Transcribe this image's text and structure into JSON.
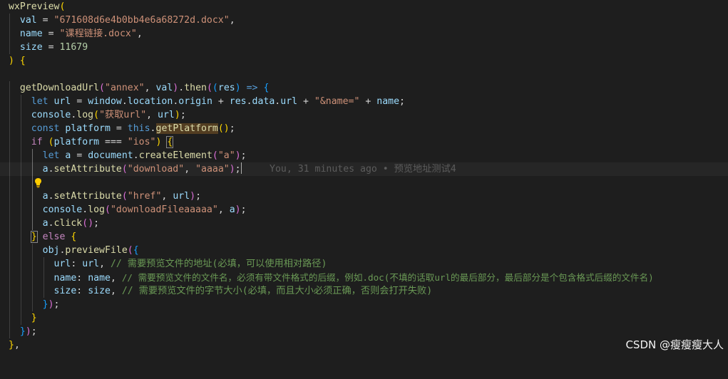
{
  "code": {
    "l1_fn": "wxPreview",
    "l1_paren": "(",
    "l2_name": "val",
    "l2_val": "\"671608d6e4b0bb4e6a68272d.docx\"",
    "l3_name": "name",
    "l3_val": "\"课程链接.docx\"",
    "l4_name": "size",
    "l4_val": "11679",
    "l5_close": ")",
    "l5_brace": "{",
    "l7_fn": "getDownloadUrl",
    "l7_arg1": "\"annex\"",
    "l7_arg2": "val",
    "l7_then": "then",
    "l7_res": "res",
    "l8_kw": "let",
    "l8_url": "url",
    "l8_window": "window",
    "l8_location": "location",
    "l8_origin": "origin",
    "l8_res": "res",
    "l8_data": "data",
    "l8_url2": "url",
    "l8_str": "\"&name=\"",
    "l8_name": "name",
    "l9_console": "console",
    "l9_log": "log",
    "l9_str": "\"获取url\"",
    "l9_url": "url",
    "l10_kw": "const",
    "l10_platform": "platform",
    "l10_this": "this",
    "l10_fn": "getPlatform",
    "l11_kw": "if",
    "l11_platform": "platform",
    "l11_str": "\"ios\"",
    "l12_kw": "let",
    "l12_a": "a",
    "l12_document": "document",
    "l12_fn": "createElement",
    "l12_str": "\"a\"",
    "l13_a": "a",
    "l13_fn": "setAttribute",
    "l13_s1": "\"download\"",
    "l13_s2": "\"aaaa\"",
    "l15_a": "a",
    "l15_fn": "setAttribute",
    "l15_s1": "\"href\"",
    "l15_url": "url",
    "l16_console": "console",
    "l16_log": "log",
    "l16_str": "\"downloadFileaaaaa\"",
    "l16_a": "a",
    "l17_a": "a",
    "l17_fn": "click",
    "l18_else": "else",
    "l19_obj": "obj",
    "l19_fn": "previewFile",
    "l20_key": "url",
    "l20_val": "url",
    "l20_cmt": "// 需要预览文件的地址(必填，可以使用相对路径)",
    "l21_key": "name",
    "l21_val": "name",
    "l21_cmt": "// 需要预览文件的文件名，必须有带文件格式的后缀，例如.doc(不填的话取url的最后部分，最后部分是个包含格式后缀的文件名)",
    "l22_key": "size",
    "l22_val": "size",
    "l22_cmt": "// 需要预览文件的字节大小(必填，而且大小必须正确，否则会打开失败)"
  },
  "blame": "You, 31 minutes ago • 预览地址测试4",
  "watermark": "CSDN @瘦瘦瘦大人",
  "colors": {
    "background": "#1e1e1e",
    "function": "#dcdcaa",
    "variable": "#9cdcfe",
    "string": "#ce9178",
    "number": "#b5cea8",
    "keyword": "#569cd6",
    "control": "#c586c0",
    "comment": "#6a9955",
    "bracket1": "#ffd700",
    "bracket2": "#da70d6",
    "bracket3": "#179fff"
  },
  "icons": {
    "gutter": "lightbulb-icon"
  }
}
